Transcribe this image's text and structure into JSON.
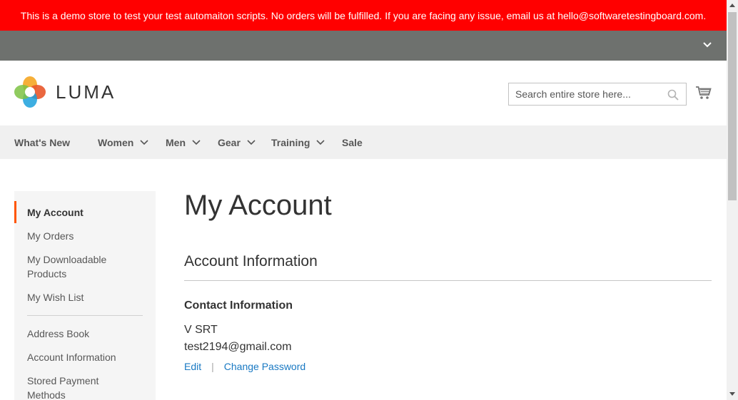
{
  "demo_banner": {
    "text": "This is a demo store to test your test automaiton scripts. No orders will be fulfilled. If you are facing any issue, email us at hello@softwaretestingboard.com."
  },
  "header": {
    "logo_text": "LUMA",
    "search_placeholder": "Search entire store here...",
    "search_icon": "search-icon",
    "cart_icon": "cart-icon"
  },
  "nav": {
    "items": [
      {
        "label": "What's New",
        "has_dropdown": false
      },
      {
        "label": "Women",
        "has_dropdown": true
      },
      {
        "label": "Men",
        "has_dropdown": true
      },
      {
        "label": "Gear",
        "has_dropdown": true
      },
      {
        "label": "Training",
        "has_dropdown": true
      },
      {
        "label": "Sale",
        "has_dropdown": false
      }
    ]
  },
  "sidebar": {
    "items": [
      {
        "label": "My Account",
        "active": true
      },
      {
        "label": "My Orders"
      },
      {
        "label": "My Downloadable Products"
      },
      {
        "label": "My Wish List"
      },
      {
        "label": "Address Book"
      },
      {
        "label": "Account Information"
      },
      {
        "label": "Stored Payment Methods"
      }
    ]
  },
  "main": {
    "page_title": "My Account",
    "section_title": "Account Information",
    "contact": {
      "title": "Contact Information",
      "name": "V SRT",
      "email": "test2194@gmail.com",
      "edit_label": "Edit",
      "separator": "|",
      "change_password_label": "Change Password"
    }
  },
  "colors": {
    "banner": "#ff0000",
    "top_bar": "#6e716e",
    "nav_bg": "#f0f0f0",
    "sidebar_bg": "#f5f5f5",
    "active_accent": "#ff5501",
    "link": "#1979c3"
  }
}
